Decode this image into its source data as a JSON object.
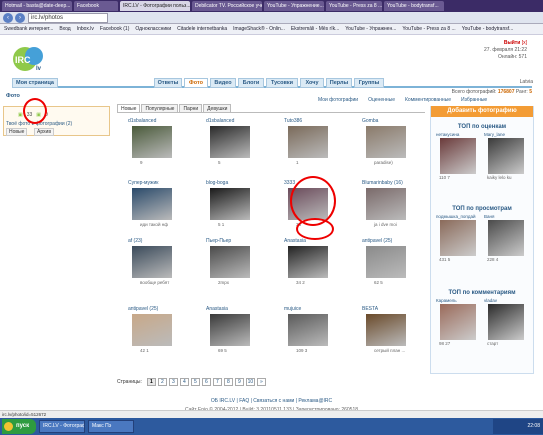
{
  "browser": {
    "tabs": [
      "Hotmail - basta@date-deep...",
      "Facebook",
      "IRC.LV - Фотографии польз...",
      "Debilcator TV. Российское уче...",
      "YouTube - Упражнение...",
      "YouTube - Press za 8 ...",
      "YouTube - bodytransf..."
    ],
    "url": "irc.lv/photos",
    "bookmarks": [
      "Swedbank интернет...",
      "Вход",
      "Inbox.lv",
      "Facebook (1)",
      "Одноклассники",
      "Citadele internetbanka",
      "ImageShack® - Onlin...",
      "Ekstremāli - Mēs rīk...",
      "YouTube - Упражнен...",
      "YouTube - Press za 8 ...",
      "YouTube - bodytransf..."
    ]
  },
  "site": {
    "logo_text": "IRC.lv",
    "top_right": {
      "exit": "Выйти",
      "date": "27. февраля 21:22",
      "online": "Онлайн: 571"
    },
    "nav": {
      "home": "Моя страница",
      "tabs": [
        "Ответы",
        "Фото",
        "Видео",
        "Блоги",
        "Тусовки",
        "Хочу",
        "Перлы",
        "Группы"
      ],
      "active": "Фото",
      "region": "Latvia"
    },
    "page_title": "Фото",
    "stats": {
      "total_label": "Всего фотографий:",
      "total": "176807",
      "rank_label": "Ранг:",
      "rank": "5"
    },
    "subnav": [
      "Мои фотографии",
      "Оцененные",
      "Комментированные",
      "Избранные"
    ],
    "left_panel": {
      "counts": [
        "33",
        "0"
      ],
      "text": "Твоё фото и фотографии (2)",
      "buttons": [
        "Новые",
        "Архив"
      ]
    },
    "content_tabs": [
      "Новые",
      "Популярные",
      "Парни",
      "Девушки"
    ],
    "photos": [
      {
        "user": "d1sbalanced",
        "meta": "9"
      },
      {
        "user": "d1sbalanced",
        "meta": "5"
      },
      {
        "user": "Tuto386",
        "meta": "1"
      },
      {
        "user": "Gomba",
        "meta": "paradise)"
      },
      {
        "user": "Супер-мужик",
        "meta": "иди такой нф"
      },
      {
        "user": "blog-boga",
        "meta": "5 1"
      },
      {
        "user": "3333",
        "meta": "33"
      },
      {
        "user": "Blumarinbaby (16)",
        "meta": "ja i dve moi"
      },
      {
        "user": "af (23)",
        "meta": "вообще ребят"
      },
      {
        "user": "Пьер-Пьер",
        "meta": "2mpx"
      },
      {
        "user": "Anastasia",
        "meta": "34 2"
      },
      {
        "user": "antipavel (25)",
        "meta": "62 5"
      },
      {
        "user": "antipavel (25)",
        "meta": "42 1"
      },
      {
        "user": "Anastasia",
        "meta": "69 5"
      },
      {
        "user": "mujuice",
        "meta": "109 3"
      },
      {
        "user": "BESTA",
        "meta": "сетрый план ..."
      }
    ],
    "right_panel": {
      "add_button": "Добавить фотографию",
      "top_rated": "ТОП по оценкам",
      "top_viewed": "ТОП по просмотрам",
      "top_commented": "ТОП по комментариям",
      "rated": [
        {
          "user": "нетакусина",
          "meta": "110 7"
        },
        {
          "user": "Mary_lane",
          "meta": "kaiky lelo ku"
        }
      ],
      "viewed": [
        {
          "user": "подмышка_попдай",
          "meta": "431 5"
        },
        {
          "user": "Ваня",
          "meta": "228 4"
        }
      ],
      "commented": [
        {
          "user": "Карамель",
          "meta": "98 27"
        },
        {
          "user": "vladav",
          "meta": "старт"
        }
      ]
    },
    "pager": {
      "label": "Страницы:",
      "pages": [
        "1",
        "2",
        "3",
        "4",
        "5",
        "6",
        "7",
        "8",
        "9",
        "10",
        "»"
      ]
    },
    "footer": {
      "line1": "ОБ IRC.LV | FAQ | Связаться с нами | Реклама@IRC",
      "line2": "Сайт Enio © 2004-2012 | Build: 3.20110511.133 | Зарегистрировано: 260518"
    }
  },
  "statusbar": "irc.lv/photo/id=512672",
  "taskbar": {
    "start": "пуск",
    "items": [
      "IRC.LV - Фотографии...",
      "Макс Пэ"
    ],
    "clock": "22:08"
  },
  "colors": {
    "accent": "#7db3d7",
    "orange": "#f39c35",
    "link": "#2a5a85",
    "marker": "#e00000"
  }
}
